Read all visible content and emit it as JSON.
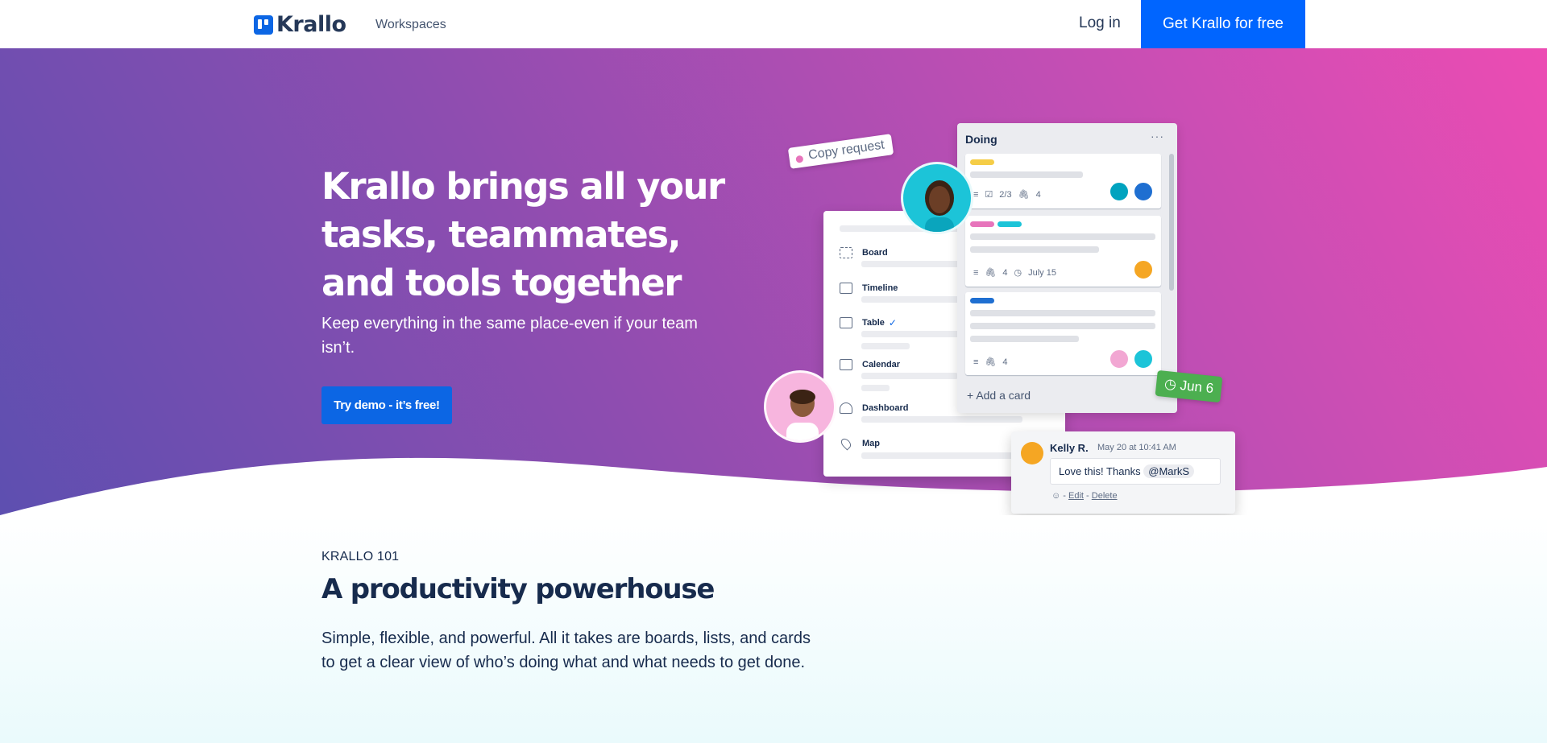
{
  "nav": {
    "brand": "Krallo",
    "workspaces": "Workspaces",
    "login": "Log in",
    "cta": "Get Krallo for free"
  },
  "hero": {
    "title": "Krallo brings all your tasks, teammates, and tools together",
    "subtitle": "Keep everything in the same place-even if your team isn’t.",
    "button": "Try demo - it’s free!"
  },
  "illustration": {
    "copy_request": "Copy request",
    "views": [
      "Board",
      "Timeline",
      "Table",
      "Calendar",
      "Dashboard",
      "Map"
    ],
    "list_title": "Doing",
    "list_more": "···",
    "card1_checklist": "2/3",
    "card1_attachments": "4",
    "card2_attachments": "4",
    "card2_date": "July 15",
    "card3_attachments": "4",
    "add_card": "Add a card",
    "due_date": "Jun 6",
    "comment": {
      "author": "Kelly R.",
      "time": "May 20 at 10:41 AM",
      "text": "Love this! Thanks",
      "mention": "@MarkS",
      "edit": "Edit",
      "delete": "Delete"
    }
  },
  "section": {
    "eyebrow": "KRALLO 101",
    "heading": "A productivity powerhouse",
    "body": "Simple, flexible, and powerful. All it takes are boards, lists, and cards to get a clear view of who’s doing what and what needs to get done."
  },
  "colors": {
    "primary": "#0065ff",
    "button": "#0c66e4",
    "gradient_start": "#5c4fb0",
    "gradient_end": "#ec4cb3",
    "due_green": "#4caf50"
  }
}
